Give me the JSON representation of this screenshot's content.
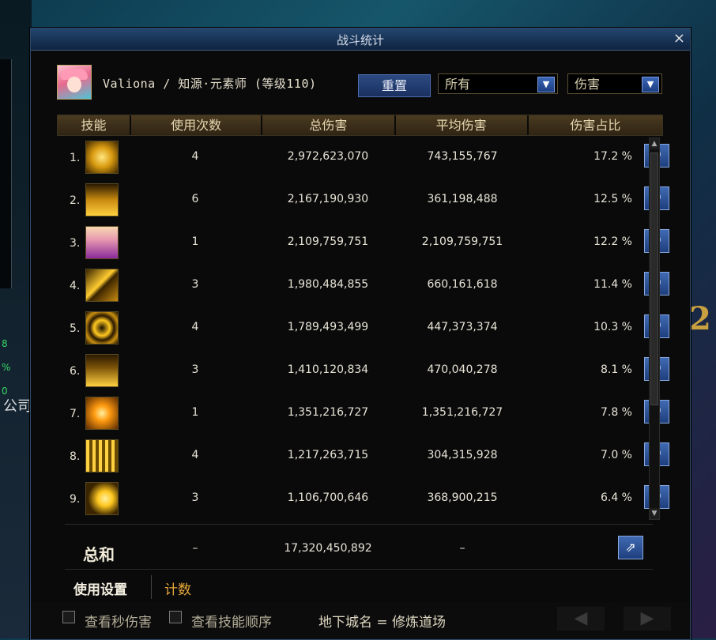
{
  "window": {
    "title": "战斗统计",
    "close_label": "×"
  },
  "header": {
    "player": "Valiona / 知源·元素师 (等级110)",
    "reset_label": "重置",
    "scope_select": "所有",
    "stat_select": "伤害",
    "dropdown_glyph": "▼"
  },
  "columns": [
    "技能",
    "使用次数",
    "总伤害",
    "平均伤害",
    "伤害占比"
  ],
  "rows": [
    {
      "idx": "1.",
      "uses": "4",
      "total": "2,972,623,070",
      "avg": "743,155,767",
      "pct": "17.2 %"
    },
    {
      "idx": "2.",
      "uses": "6",
      "total": "2,167,190,930",
      "avg": "361,198,488",
      "pct": "12.5 %"
    },
    {
      "idx": "3.",
      "uses": "1",
      "total": "2,109,759,751",
      "avg": "2,109,759,751",
      "pct": "12.2 %"
    },
    {
      "idx": "4.",
      "uses": "3",
      "total": "1,980,484,855",
      "avg": "660,161,618",
      "pct": "11.4 %"
    },
    {
      "idx": "5.",
      "uses": "4",
      "total": "1,789,493,499",
      "avg": "447,373,374",
      "pct": "10.3 %"
    },
    {
      "idx": "6.",
      "uses": "3",
      "total": "1,410,120,834",
      "avg": "470,040,278",
      "pct": "8.1 %"
    },
    {
      "idx": "7.",
      "uses": "1",
      "total": "1,351,216,727",
      "avg": "1,351,216,727",
      "pct": "7.8 %"
    },
    {
      "idx": "8.",
      "uses": "4",
      "total": "1,217,263,715",
      "avg": "304,315,928",
      "pct": "7.0 %"
    },
    {
      "idx": "9.",
      "uses": "3",
      "total": "1,106,700,646",
      "avg": "368,900,215",
      "pct": "6.4 %"
    }
  ],
  "totals": {
    "label": "总和",
    "uses": "–",
    "total": "17,320,450,892",
    "avg": "–"
  },
  "tabs": {
    "usage": "使用设置",
    "count": "计数"
  },
  "footer": {
    "dps_checkbox": "查看秒伤害",
    "order_checkbox": "查看技能顺序",
    "dungeon": "地下城名 = 修炼道场",
    "prev": "◀",
    "next": "▶"
  },
  "export_glyph": "⇗",
  "background": {
    "side_text": "公司",
    "glyph": "2"
  },
  "colors": {
    "accent_title": "#24466e",
    "header_bar": "#4a3a20",
    "tab_active": "#f4efe0",
    "tab_count": "#e8a83a"
  }
}
